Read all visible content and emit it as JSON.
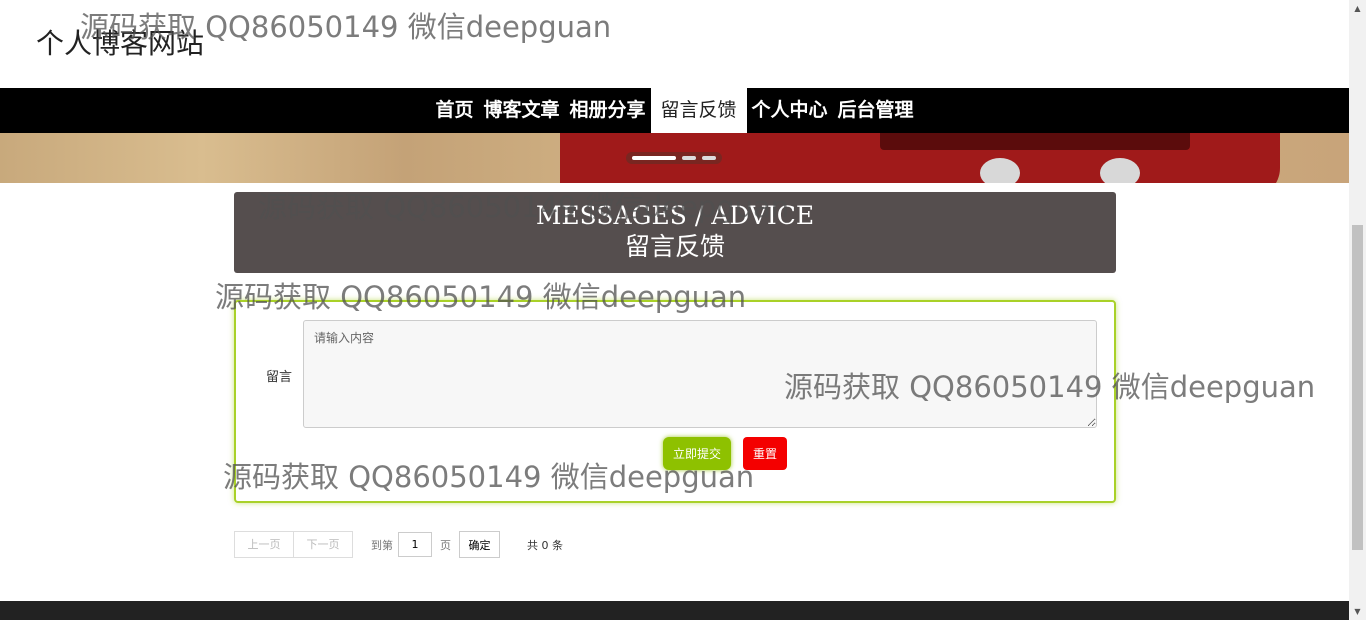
{
  "site": {
    "title": "个人博客网站"
  },
  "nav": {
    "items": [
      {
        "label": "首页"
      },
      {
        "label": "博客文章"
      },
      {
        "label": "相册分享"
      },
      {
        "label": "留言反馈",
        "active": true
      },
      {
        "label": "个人中心"
      },
      {
        "label": "后台管理"
      }
    ]
  },
  "hero": {
    "title_en": "MESSAGES / ADVICE",
    "title_cn": "留言反馈"
  },
  "form": {
    "label": "留言",
    "placeholder": "请输入内容",
    "submit_label": "立即提交",
    "reset_label": "重置"
  },
  "pagination": {
    "prev_label": "上一页",
    "next_label": "下一页",
    "goto_label": "到第",
    "page_value": "1",
    "page_unit": "页",
    "confirm_label": "确定",
    "total_text": "共 0 条"
  },
  "watermark": {
    "text": "源码获取 QQ86050149 微信deepguan"
  },
  "colors": {
    "nav_bg": "#000000",
    "hero_bg": "#554e4e",
    "submit": "#8ec100",
    "reset": "#f40000",
    "form_border": "#a9d128"
  }
}
